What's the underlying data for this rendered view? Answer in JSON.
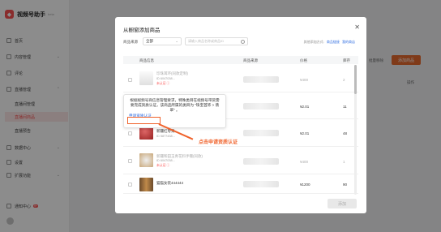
{
  "app": {
    "title": "视频号助手",
    "subtitle": "beta"
  },
  "sidebar": {
    "items": [
      {
        "label": "首页"
      },
      {
        "label": "内容管理"
      },
      {
        "label": "评论"
      },
      {
        "label": "直播管理"
      },
      {
        "label": "数据中心"
      },
      {
        "label": "设置"
      },
      {
        "label": "扩展功能"
      }
    ],
    "sub_items": [
      {
        "label": "直播间管理"
      },
      {
        "label": "直播间商品"
      },
      {
        "label": "直播预告"
      }
    ],
    "bottom": {
      "label": "通知中心",
      "badge": "9+"
    }
  },
  "background": {
    "primary_button": "添加商品",
    "op_header": "操作",
    "link_text": "批量移除"
  },
  "modal": {
    "title": "从橱窗添加商品",
    "close_icon": "close-icon",
    "filter": {
      "label": "商品来源",
      "value": "全部"
    },
    "search": {
      "placeholder": "请输入商品名称或商品ID"
    },
    "links_prefix": "其他添加方式:",
    "link_1": "商品链接",
    "link_2": "我的商店",
    "columns": [
      "商品信息",
      "商品来源",
      "价格",
      "库存"
    ],
    "rows": [
      {
        "name": "珍珠耳环(同款定制)",
        "sub": "ID 6047038...",
        "tag": "未认证 ⓘ",
        "price": "¥400",
        "stock": "2",
        "dim": true
      },
      {
        "name": "",
        "sub": "",
        "tag": "",
        "price": "¥2.01",
        "stock": "11",
        "dim": false
      },
      {
        "name": "新疆红枣果",
        "sub": "ID 5877438...",
        "tag": "",
        "price": "¥2.01",
        "stock": "48",
        "dim": false
      },
      {
        "name": "新疆和田玉青花料手镯(同款)",
        "sub": "ID 6047038...",
        "tag": "未认证 ⓘ",
        "price": "¥400",
        "stock": "1",
        "dim": true
      },
      {
        "name": "猫猫女装444444",
        "sub": "",
        "tag": "",
        "price": "¥1200",
        "stock": "90",
        "dim": false
      }
    ],
    "add_button": "添加"
  },
  "tooltip": {
    "text": "根据视频号商信息管理要求，特殊类目在视频号带货需要完成资质认证，该商品所属的类目为 \"珠宝首饰 > 翡翠\" 。",
    "link": "申请资质认证"
  },
  "annotation": {
    "text": "点击申请资质认证",
    "color": "#f0622b"
  }
}
